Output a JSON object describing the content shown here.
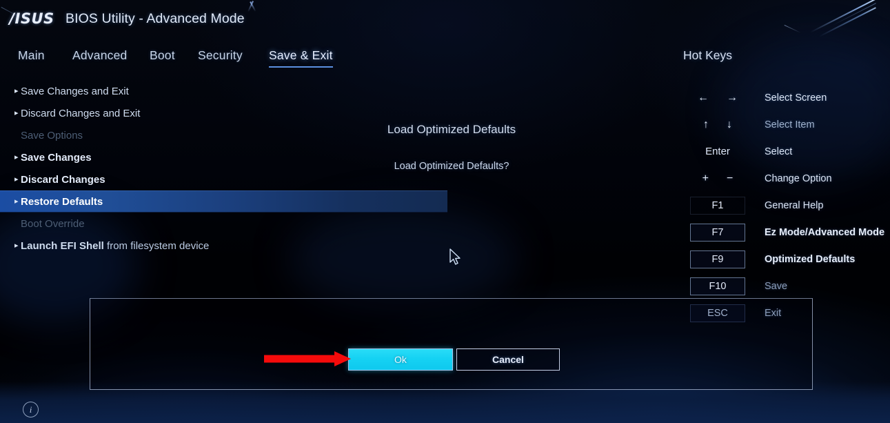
{
  "header": {
    "logo": "/ISUS",
    "title": "BIOS Utility - Advanced Mode"
  },
  "nav": {
    "tabs": [
      {
        "label": "Main",
        "active": false
      },
      {
        "label": "Advanced",
        "active": false
      },
      {
        "label": "Boot",
        "active": false
      },
      {
        "label": "Security",
        "active": false
      },
      {
        "label": "Save & Exit",
        "active": true
      }
    ],
    "hotkeys_title": "Hot Keys"
  },
  "menu": {
    "items": [
      {
        "label": "Save Changes and Exit",
        "caret": "▸",
        "state": "normal"
      },
      {
        "label": "Discard Changes and Exit",
        "caret": "▸",
        "state": "normal"
      },
      {
        "label": "Save Options",
        "caret": "",
        "state": "dim"
      },
      {
        "label": "Save Changes",
        "caret": "▸",
        "state": "bold"
      },
      {
        "label": "Discard Changes",
        "caret": "▸",
        "state": "bold"
      },
      {
        "label": "Restore Defaults",
        "caret": "▸",
        "state": "selected"
      },
      {
        "label": "Boot Override",
        "caret": "",
        "state": "dim"
      },
      {
        "label": "Launch EFI Shell from filesystem device",
        "caret": "▸",
        "state": "split",
        "lead": "Launch EFI Shell",
        "tail": " from filesystem device"
      }
    ]
  },
  "dialog": {
    "title": "Load Optimized Defaults",
    "message": "Load Optimized Defaults?",
    "ok_label": "Ok",
    "cancel_label": "Cancel"
  },
  "hotkeys": {
    "rows": [
      {
        "keys": [
          "←",
          "→"
        ],
        "type": "glyph",
        "desc": "Select Screen",
        "style": "normal"
      },
      {
        "keys": [
          "↑",
          "↓"
        ],
        "type": "glyph",
        "desc": "Select Item",
        "style": "dim"
      },
      {
        "keys": [
          "Enter"
        ],
        "type": "text",
        "desc": "Select",
        "style": "normal"
      },
      {
        "keys": [
          "+",
          "−"
        ],
        "type": "glyph",
        "desc": "Change Option",
        "style": "normal"
      },
      {
        "keys": [
          "F1"
        ],
        "type": "box-noborder",
        "desc": "General Help",
        "style": "normal"
      },
      {
        "keys": [
          "F7"
        ],
        "type": "box",
        "desc": "Ez Mode/Advanced Mode",
        "style": "bold"
      },
      {
        "keys": [
          "F9"
        ],
        "type": "box",
        "desc": "Optimized Defaults",
        "style": "bold"
      },
      {
        "keys": [
          "F10"
        ],
        "type": "box",
        "desc": "Save",
        "style": "faded"
      },
      {
        "keys": [
          "ESC"
        ],
        "type": "box-faded",
        "desc": "Exit",
        "style": "faded"
      }
    ]
  },
  "footer": {
    "info_icon_glyph": "i"
  },
  "annotation": {
    "arrow_color": "#f50b0b",
    "points_to": "Ok"
  },
  "colors": {
    "accent_cyan": "#15d2f3",
    "selection_blue": "#1b4da3",
    "background": "#000205"
  }
}
